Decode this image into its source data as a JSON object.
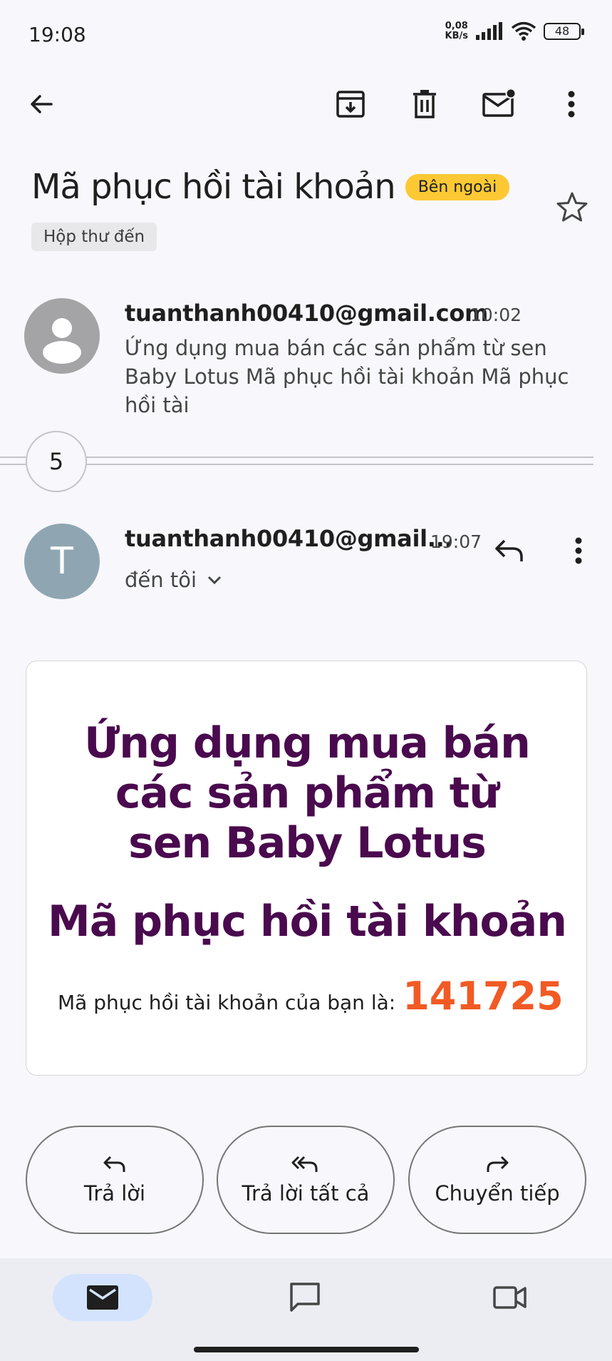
{
  "status_bar": {
    "time": "19:08",
    "net_speed_value": "0,08",
    "net_speed_unit": "KB/s",
    "battery": "48"
  },
  "toolbar": {
    "icons": [
      "back-arrow-icon",
      "archive-icon",
      "delete-icon",
      "mark-unread-icon",
      "more-vert-icon"
    ]
  },
  "email": {
    "subject": "Mã phục hồi tài khoản",
    "external_badge": "Bên ngoài",
    "folder_label": "Hộp thư đến",
    "collapsed_message": {
      "sender": "tuanthanh00410@gmail.com",
      "time": "10:02",
      "snippet": "Ứng dụng mua bán các sản phẩm từ sen Baby Lotus Mã phục hồi tài khoản Mã phục hồi tài"
    },
    "hidden_count": "5",
    "expanded_message": {
      "avatar_letter": "T",
      "sender": "tuanthanh00410@gmail...",
      "time": "19:07",
      "recipient": "đến tôi"
    },
    "body": {
      "title": "Ứng dụng mua bán các sản phẩm từ sen Baby Lotus",
      "subtitle": "Mã phục hồi tài khoản",
      "code_label": "Mã phục hồi tài khoản của bạn là:",
      "code_value": "141725"
    }
  },
  "actions": {
    "reply": "Trả lời",
    "reply_all": "Trả lời tất cả",
    "forward": "Chuyển tiếp"
  },
  "bottom_nav": {
    "items": [
      "mail-icon",
      "chat-icon",
      "meet-icon"
    ],
    "active": "mail"
  },
  "colors": {
    "badge_external": "#fcc934",
    "title_purple": "#4a0a4e",
    "code_orange": "#f15a24",
    "nav_active": "#d3e3fd"
  }
}
